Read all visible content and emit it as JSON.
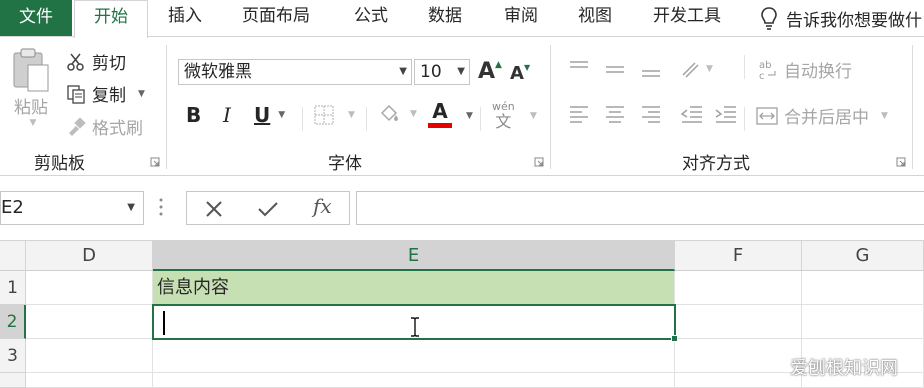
{
  "tabs": {
    "file": "文件",
    "items": [
      "开始",
      "插入",
      "页面布局",
      "公式",
      "数据",
      "审阅",
      "视图",
      "开发工具"
    ],
    "tell_me": "告诉我你想要做什"
  },
  "clipboard": {
    "paste": "粘贴",
    "cut": "剪切",
    "copy": "复制",
    "format_painter": "格式刷",
    "label": "剪贴板"
  },
  "font": {
    "name": "微软雅黑",
    "size": "10",
    "bold": "B",
    "italic": "I",
    "underline": "U",
    "grow": "A",
    "shrink": "A",
    "font_color_letter": "A",
    "phonetic_top": "wén",
    "phonetic_bottom": "文",
    "label": "字体"
  },
  "alignment": {
    "wrap": "自动换行",
    "merge": "合并后居中",
    "label": "对齐方式"
  },
  "formula_bar": {
    "name_box": "E2",
    "fx": "fx",
    "value": ""
  },
  "grid": {
    "columns": [
      "D",
      "E",
      "F",
      "G"
    ],
    "selected_column": "E",
    "rows": [
      "1",
      "2",
      "3"
    ],
    "selected_row": "2",
    "cells": {
      "E1": "信息内容",
      "E2": ""
    }
  },
  "watermark": "爱刨根知识网",
  "colors": {
    "accent": "#217346",
    "header_fill": "#c6e0b4",
    "font_color_bar": "#e60000"
  }
}
